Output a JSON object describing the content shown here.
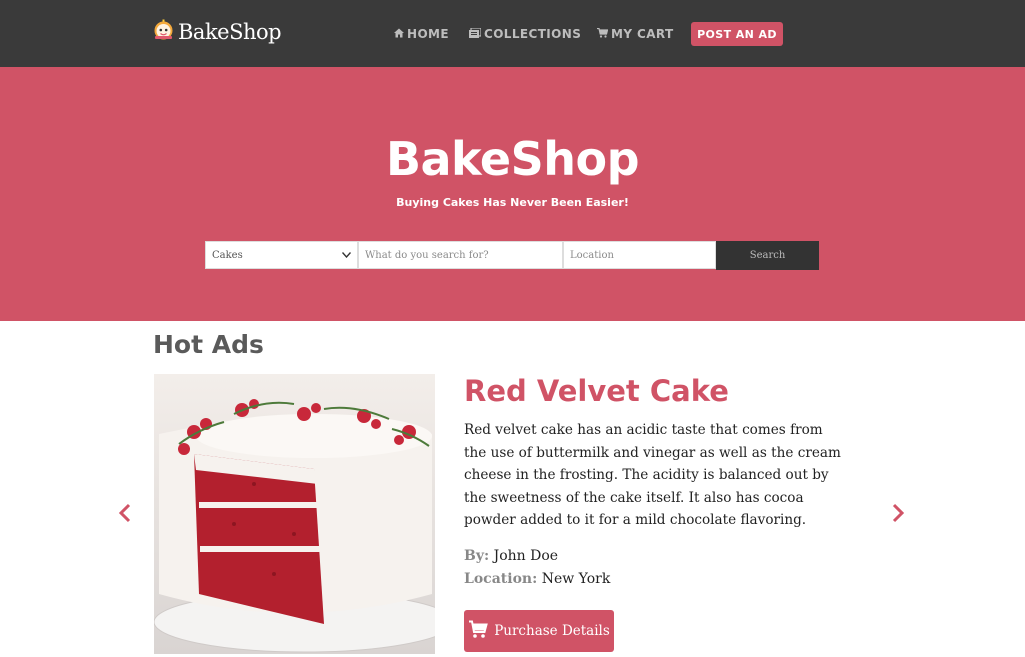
{
  "brand": {
    "name": "BakeShop",
    "logo_icon": "cake-icon"
  },
  "nav": {
    "home": {
      "label": "HOME",
      "icon": "home-icon"
    },
    "collections": {
      "label": "COLLECTIONS",
      "icon": "collections-icon"
    },
    "cart": {
      "label": "MY CART",
      "icon": "cart-icon"
    },
    "post_ad": "POST AN AD"
  },
  "hero": {
    "title": "BakeShop",
    "subtitle": "Buying Cakes Has Never Been Easier!"
  },
  "search": {
    "category_value": "Cakes",
    "query_placeholder": "What do you search for?",
    "location_placeholder": "Location",
    "button_label": "Search"
  },
  "hot_ads": {
    "title": "Hot Ads",
    "item": {
      "title": "Red Velvet Cake",
      "description": "Red velvet cake has an acidic taste that comes from the use of buttermilk and vinegar as well as the cream cheese in the frosting. The acidity is balanced out by the sweetness of the cake itself. It also has cocoa powder added to it for a mild chocolate flavoring.",
      "by_label": "By:",
      "by_value": "John Doe",
      "location_label": "Location:",
      "location_value": "New York",
      "button_label": "Purchase Details",
      "button_icon": "cart-icon"
    }
  },
  "colors": {
    "nav_bg": "#3a3a3a",
    "accent": "#d05366",
    "search_btn": "#333333"
  }
}
